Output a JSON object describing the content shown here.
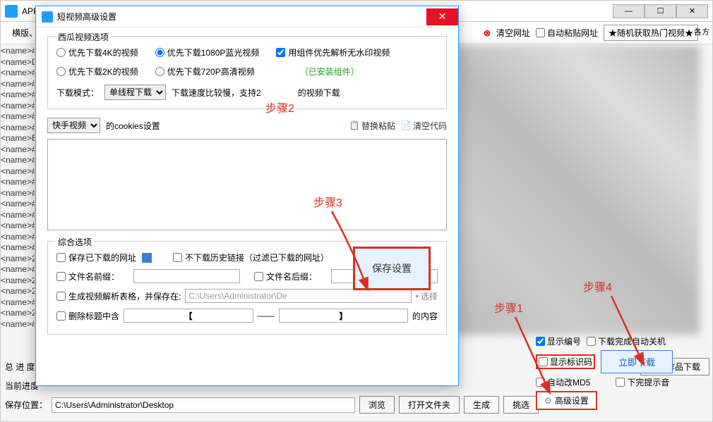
{
  "bg": {
    "title": "APP",
    "tab": "横版、",
    "right_toolbar": {
      "clear_url": "清空网址",
      "auto_paste": "自动粘贴网址",
      "random_hot": "★随机获取热门视频★",
      "right_label": "各方"
    },
    "left_rows": [
      "<name>#",
      "<name>D",
      "<name>#",
      "<name>#",
      "<name>#",
      "<name>#",
      "<name>#",
      "<name>#",
      "<name>B",
      "<name>#",
      "<name>#",
      "<name>#",
      "<name>#",
      "<name>#",
      "<name>#",
      "<name>#",
      "<name>#",
      "<name>#",
      "<name>#",
      "<name>2",
      "<name>#",
      "<name>2",
      "<name>2",
      "<name>#",
      "<name>2",
      "<name>#"
    ],
    "bottom": {
      "total_progress": "总 进 度",
      "current_progress": "当前进度",
      "save_location": "保存位置：",
      "save_path": "C:\\Users\\Administrator\\Desktop",
      "browse": "浏览",
      "open_folder": "打开文件夹",
      "generate": "生成",
      "select": "挑选",
      "author_download": "作者作品下载",
      "show_number": "显示编号",
      "show_id": "显示标识码",
      "auto_md5": "自动改MD5",
      "auto_shutdown": "下载完成自动关机",
      "download_now": "立即下载",
      "no_sound": "下完提示音",
      "advanced": "高级设置"
    }
  },
  "dlg": {
    "title": "短视频高级设置",
    "group1_title": "西瓜视频选项",
    "r1": "优先下载4K的视频",
    "r2": "优先下载1080P蓝光视频",
    "r3": "优先下载2K的视频",
    "r4": "优先下载720P高清视频",
    "chk_component": "用组件优先解析无水印视频",
    "installed": "（已安装组件）",
    "mode_label": "下载模式：",
    "mode_value": "单线程下载",
    "mode_hint": "下载速度比较慢，支持2",
    "mode_hint2": "的视频下载",
    "cookies_sel": "快手视频",
    "cookies_label": "的cookies设置",
    "paste": "替换粘贴",
    "clear_code": "清空代码",
    "group2_title": "综合选项",
    "save_url": "保存已下载的网址",
    "no_history": "不下载历史链接（过滤已下载的网址）",
    "prefix": "文件名前缀：",
    "suffix": "文件名后缀：",
    "gen_table": "生成视频解析表格，并保存在:",
    "table_path": "C:\\Users\\Administrator\\De",
    "select_btn": "选择",
    "del_title": "删除标题中含",
    "bracket_l": "【",
    "dash": "——",
    "bracket_r": "】",
    "del_tail": "的内容",
    "save_settings": "保存设置"
  },
  "annot": {
    "step1": "步骤1",
    "step2": "步骤2",
    "step3": "步骤3",
    "step4": "步骤4"
  }
}
